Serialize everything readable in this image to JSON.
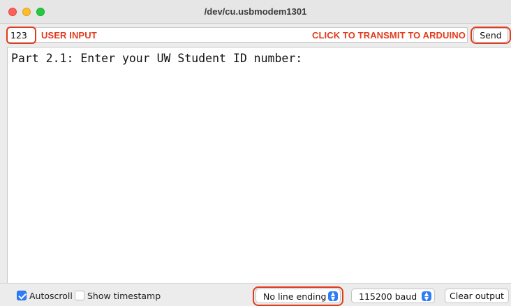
{
  "window": {
    "title": "/dev/cu.usbmodem1301"
  },
  "input": {
    "value": "123",
    "annotation_left": "USER INPUT",
    "annotation_right": "CLICK TO TRANSMIT TO ARDUINO",
    "send_label": "Send"
  },
  "output": {
    "lines": [
      "Part 2.1: Enter your UW Student ID number:"
    ]
  },
  "bottom": {
    "autoscroll_label": "Autoscroll",
    "autoscroll_checked": true,
    "timestamp_label": "Show timestamp",
    "timestamp_checked": false,
    "line_ending": "No line ending",
    "baud": "115200 baud",
    "clear_label": "Clear output"
  },
  "colors": {
    "annotation": "#e23b1e",
    "accent": "#2e7cf6"
  },
  "icons": [
    "close-button-icon",
    "minimize-button-icon",
    "maximize-button-icon",
    "checkbox-checked-icon",
    "checkbox-unchecked-icon",
    "select-arrows-icon"
  ]
}
